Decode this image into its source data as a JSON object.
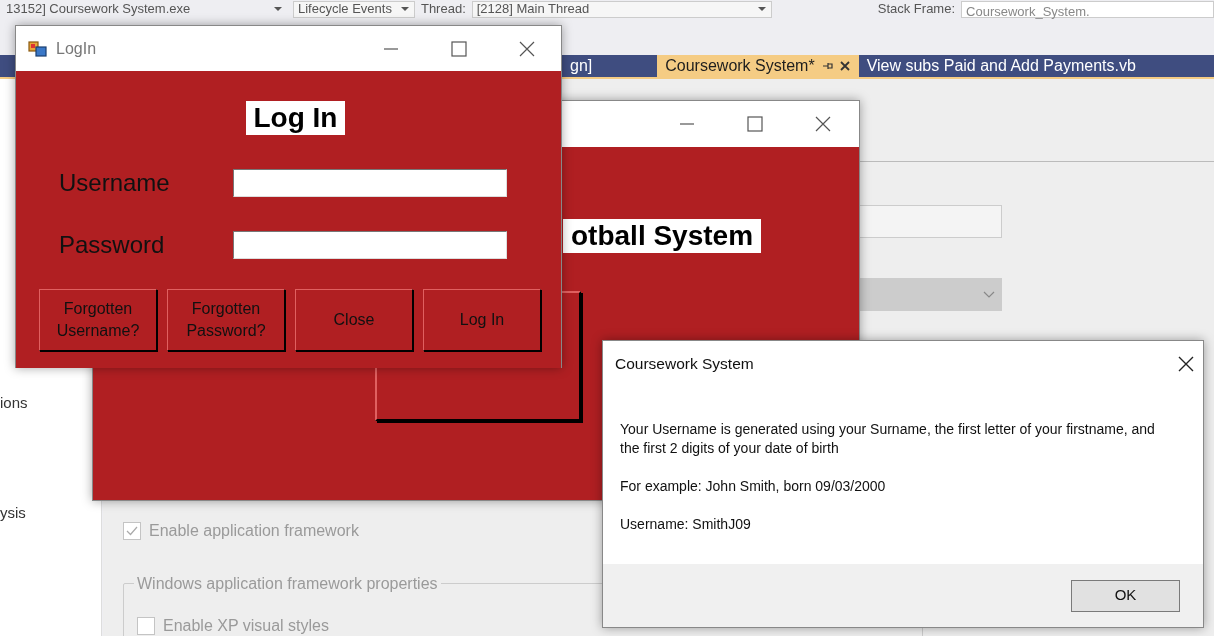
{
  "ide": {
    "toolbar": [
      {
        "kind": "dropdown",
        "text": "13152] Coursework System.exe"
      },
      {
        "kind": "dropdown",
        "text": "Lifecycle Events"
      },
      {
        "kind": "label",
        "text": "Thread:"
      },
      {
        "kind": "dropdown",
        "text": "[2128] Main Thread"
      },
      {
        "kind": "label",
        "text": "Stack Frame:"
      },
      {
        "kind": "field",
        "text": "Coursework_System."
      }
    ],
    "tabs": [
      {
        "label": "gn]",
        "selected": false
      },
      {
        "label": "Coursework System*",
        "selected": true
      },
      {
        "label": "View subs Paid and Add Payments.vb",
        "selected": false
      }
    ],
    "sidebar_items": [
      "ions",
      "ysis"
    ],
    "properties": {
      "dropdown": {
        "disabled": true
      },
      "checkboxes": [
        {
          "label": "Enable application framework",
          "checked": true,
          "disabled": true
        }
      ],
      "groupbox": {
        "title": "Windows application framework properties",
        "checkboxes": [
          {
            "label": "Enable XP visual styles",
            "checked": false,
            "disabled": true
          }
        ]
      }
    }
  },
  "football_window": {
    "heading": "otball System"
  },
  "login_window": {
    "title": "LogIn",
    "heading": "Log In",
    "fields": [
      {
        "label": "Username"
      },
      {
        "label": "Password"
      }
    ],
    "buttons": [
      "Forgotten Username?",
      "Forgotten Password?",
      "Close",
      "Log In"
    ]
  },
  "message_box": {
    "title": "Coursework System",
    "paragraphs": [
      "Your Username is generated using your Surname, the first letter of your firstname, and the first 2 digits of your date of birth",
      "For example: John Smith, born 09/03/2000",
      "Username: SmithJ09"
    ],
    "button": "OK"
  }
}
